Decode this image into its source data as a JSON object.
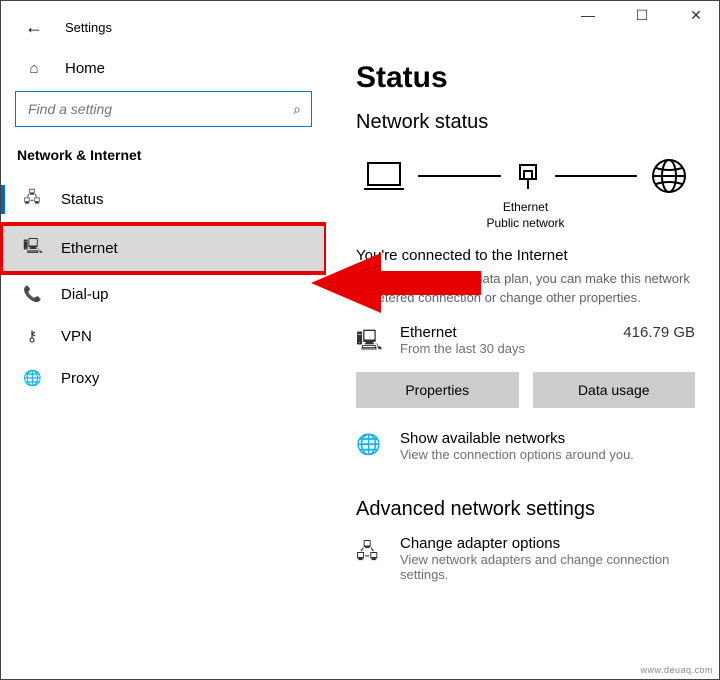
{
  "window": {
    "minimize": "—",
    "maximize": "☐",
    "close": "✕"
  },
  "header": {
    "back": "←",
    "title": "Settings"
  },
  "sidebar": {
    "home": "Home",
    "search_placeholder": "Find a setting",
    "category": "Network & Internet",
    "items": [
      {
        "icon": "🖧",
        "label": "Status"
      },
      {
        "icon": "🖳",
        "label": "Ethernet"
      },
      {
        "icon": "📞",
        "label": "Dial-up"
      },
      {
        "icon": "⚷",
        "label": "VPN"
      },
      {
        "icon": "🌐",
        "label": "Proxy"
      }
    ]
  },
  "content": {
    "title": "Status",
    "section_heading": "Network status",
    "diagram": {
      "center_label_1": "Ethernet",
      "center_label_2": "Public network"
    },
    "status_line": "You're connected to the Internet",
    "status_sub": "If you have a limited data plan, you can make this network a metered connection or change other properties.",
    "usage": {
      "name": "Ethernet",
      "sub": "From the last 30 days",
      "amount": "416.79 GB"
    },
    "buttons": {
      "properties": "Properties",
      "data_usage": "Data usage"
    },
    "available": {
      "title": "Show available networks",
      "sub": "View the connection options around you."
    },
    "advanced_heading": "Advanced network settings",
    "adapter": {
      "title": "Change adapter options",
      "sub": "View network adapters and change connection settings."
    }
  },
  "watermark": "www.deuaq.com"
}
